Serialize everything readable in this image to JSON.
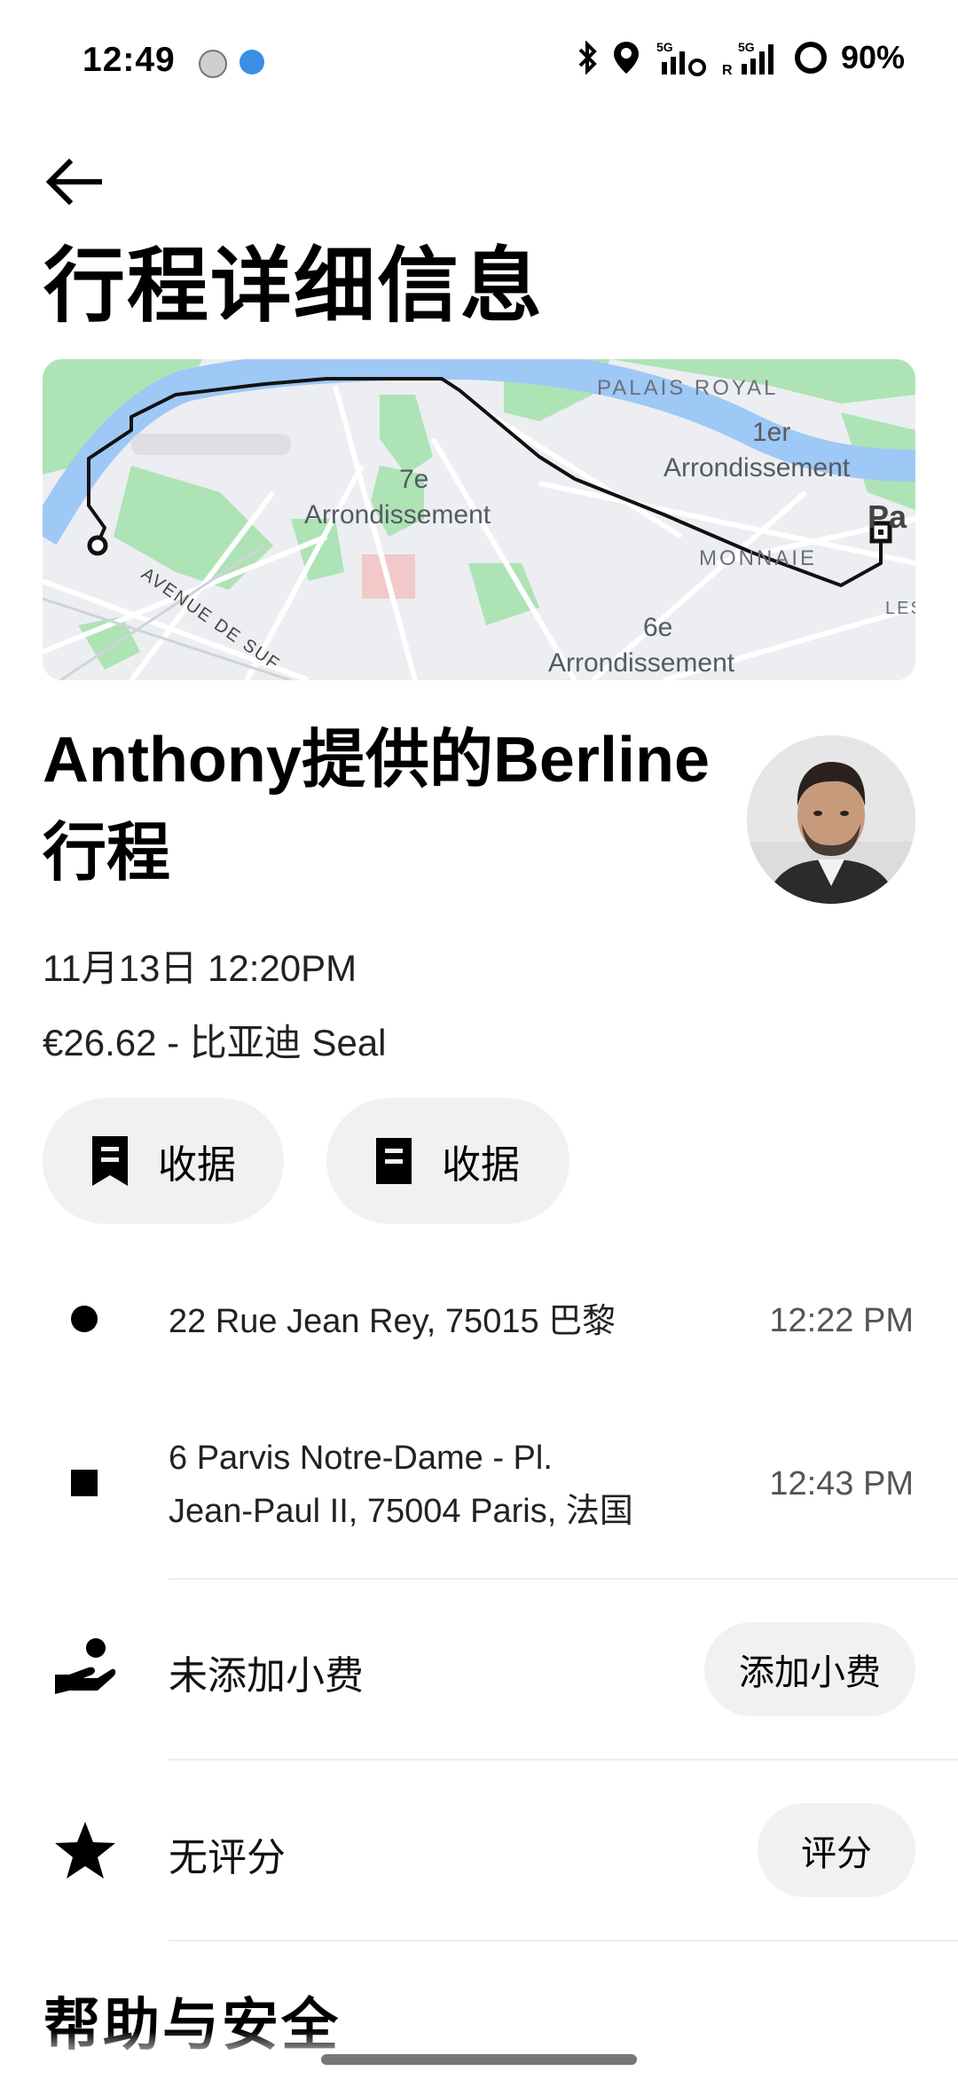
{
  "status_bar": {
    "time": "12:49",
    "battery": "90%",
    "signal_1": "5G",
    "signal_2": "5G",
    "roaming": "R",
    "icons": [
      "bluetooth-icon",
      "location-icon",
      "signal-5g-icon",
      "signal-5g-roaming-icon",
      "battery-ring-icon"
    ]
  },
  "header": {
    "title": "行程详细信息"
  },
  "map": {
    "labels": {
      "palais_royal": "PALAIS ROYAL",
      "first_arr_num": "1er",
      "first_arr": "Arrondissement",
      "seventh_arr_num": "7e",
      "seventh_arr": "Arrondissement",
      "monnaie": "MONNAIE",
      "sixth_arr_num": "6e",
      "sixth_arr": "Arrondissement",
      "avenue": "AVENUE DE SUF",
      "paris_partial": "Pa",
      "les_partial": "LES"
    }
  },
  "trip": {
    "heading": "Anthony提供的Berline行程",
    "datetime": "11月13日 12:20PM",
    "fare": "€26.62 - 比亚迪 Seal"
  },
  "actions": {
    "receipt_1": "收据",
    "receipt_2": "收据"
  },
  "route": {
    "pickup_address": "22 Rue Jean Rey, 75015 巴黎",
    "pickup_time": "12:22 PM",
    "dropoff_address_line1": "6 Parvis Notre-Dame - Pl.",
    "dropoff_address_line2": "Jean-Paul II, 75004 Paris, 法国",
    "dropoff_time": "12:43 PM"
  },
  "tip": {
    "label": "未添加小费",
    "button": "添加小费"
  },
  "rating": {
    "label": "无评分",
    "button": "评分"
  },
  "help": {
    "title": "帮助与安全"
  },
  "colors": {
    "map_park": "#aee3b6",
    "map_water": "#9ec8f5",
    "map_base": "#eceef1",
    "pill_bg": "#f1f1f1"
  }
}
